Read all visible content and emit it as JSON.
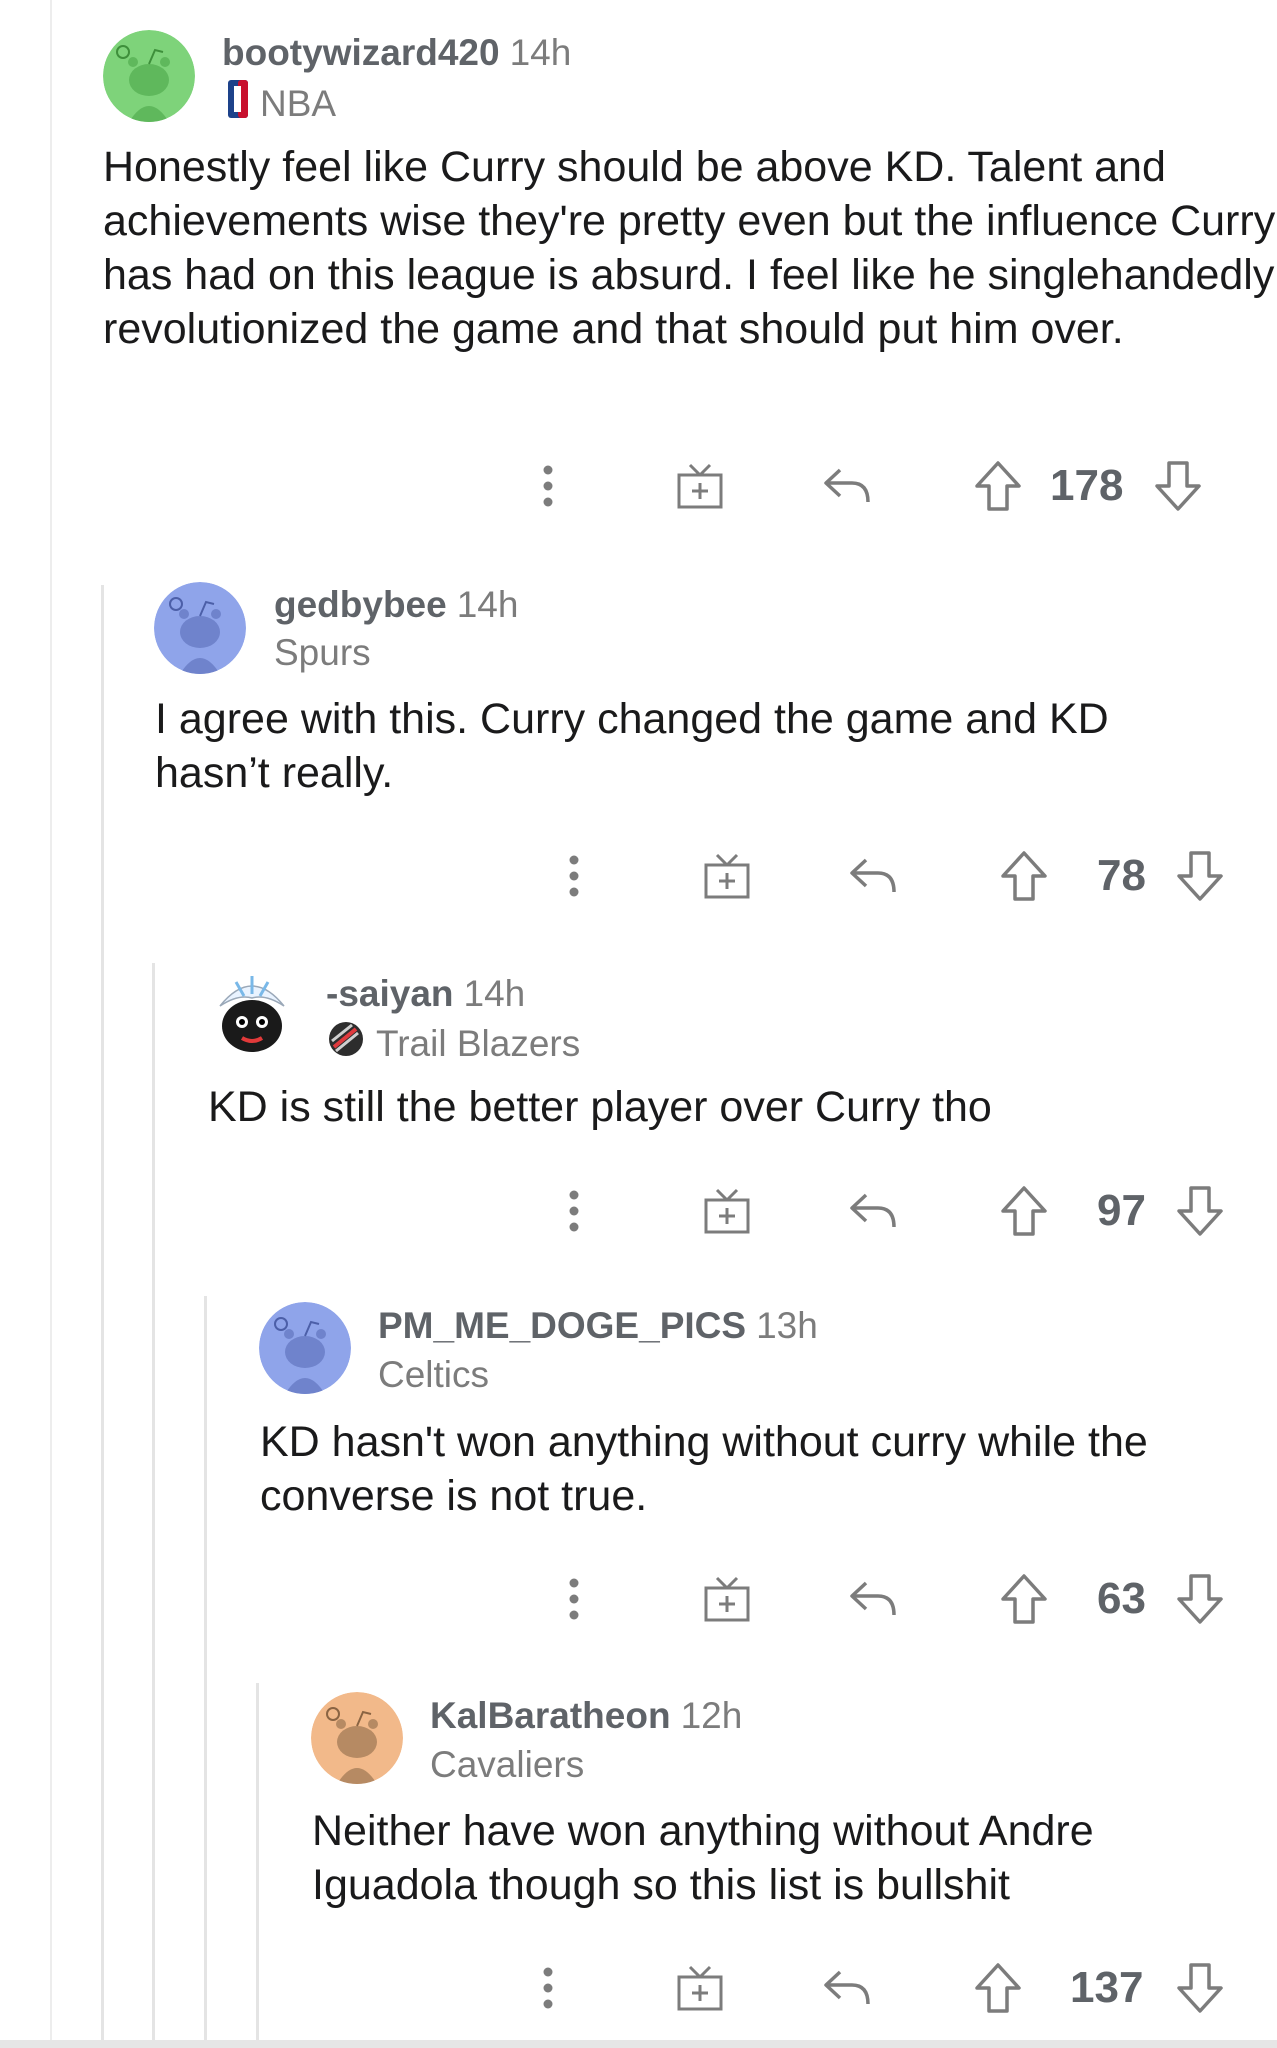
{
  "comments": [
    {
      "username": "bootywizard420",
      "age": "14h",
      "flair": "NBA",
      "flair_icon": "nba-logo-icon",
      "avatar_color": "#7ed37a",
      "body": "Honestly feel like Curry should be above KD. Talent and achievements wise they're pretty even but the influence Curry has had on this league is absurd. I feel like he singlehandedly revolutionized the game and that should put him over.",
      "score": "178"
    },
    {
      "username": "gedbybee",
      "age": "14h",
      "flair": "Spurs",
      "avatar_color": "#8fa4ea",
      "body": "I agree with this. Curry changed the game and KD hasn’t really.",
      "score": "78"
    },
    {
      "username": "-saiyan",
      "age": "14h",
      "flair": "Trail Blazers",
      "flair_icon": "trail-blazers-logo-icon",
      "avatar_color": "#ffffff",
      "body": "KD is still the better player over Curry tho",
      "score": "97"
    },
    {
      "username": "PM_ME_DOGE_PICS",
      "age": "13h",
      "flair": "Celtics",
      "avatar_color": "#8fa4ea",
      "body": "KD hasn't won anything without curry while the converse is not true.",
      "score": "63"
    },
    {
      "username": "KalBaratheon",
      "age": "12h",
      "flair": "Cavaliers",
      "avatar_color": "#f2b98a",
      "body": "Neither have won anything without Andre Iguadola though so this list is bullshit",
      "score": "137"
    }
  ],
  "action_icons": [
    "more-options-icon",
    "award-icon",
    "reply-icon",
    "upvote-icon",
    "downvote-icon"
  ]
}
